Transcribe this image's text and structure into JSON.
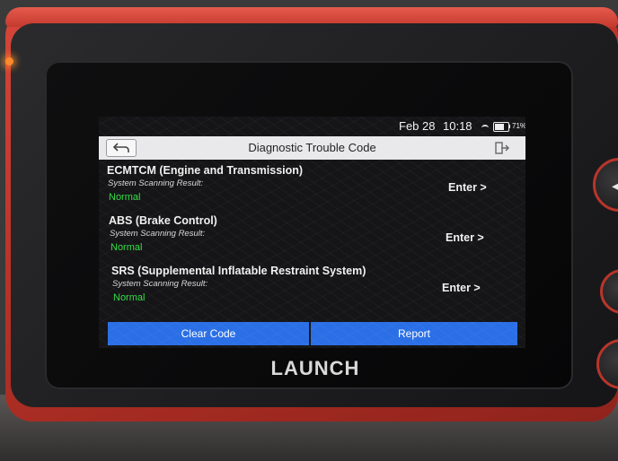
{
  "status_bar": {
    "date": "Feb 28",
    "time": "10:18",
    "battery_percent": "71%",
    "battery_level": 0.71
  },
  "header": {
    "title": "Diagnostic Trouble Code",
    "back_icon": "back-arrow-icon",
    "exit_icon": "exit-icon"
  },
  "systems": [
    {
      "name": "ECMTCM (Engine and Transmission)",
      "scan_label": "System Scanning Result:",
      "result": "Normal",
      "action": "Enter >"
    },
    {
      "name": "ABS (Brake Control)",
      "scan_label": "System Scanning Result:",
      "result": "Normal",
      "action": "Enter >"
    },
    {
      "name": "SRS (Supplemental Inflatable Restraint System)",
      "scan_label": "System Scanning Result:",
      "result": "Normal",
      "action": "Enter >"
    }
  ],
  "footer": {
    "clear_label": "Clear Code",
    "report_label": "Report"
  },
  "device": {
    "brand": "LAUNCH",
    "side_button_icon": "chevron-left-icon"
  },
  "colors": {
    "accent": "#2b6fe6",
    "normal": "#33dd44",
    "bumper": "#c53a2e"
  }
}
